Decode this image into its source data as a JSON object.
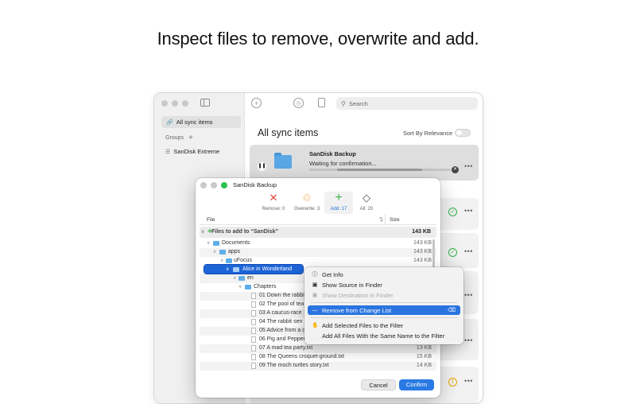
{
  "headline": "Inspect files to remove, overwrite and add.",
  "main": {
    "sidebar": {
      "all_sync": "All sync items",
      "groups": "Groups",
      "groups_add": "+",
      "drive": "SanDisk Extreme"
    },
    "toolbar": {
      "add": "+",
      "search_placeholder": "Search"
    },
    "title": "All sync items",
    "sort_label": "Sort By Relevance",
    "card": {
      "name": "SanDisk Backup",
      "status": "Waiting for confirmation...",
      "progress_fraction": 0.8
    },
    "more": "•••"
  },
  "dialog": {
    "title": "SanDisk Backup",
    "tabs": [
      {
        "glyph": "✕",
        "label": "Remove: 0"
      },
      {
        "glyph": "♲",
        "label": "Overwrite: 3"
      },
      {
        "glyph": "+",
        "label": "Add: 17"
      },
      {
        "glyph": "◇",
        "label": "All: 20"
      }
    ],
    "columns": {
      "file": "File",
      "size": "Size"
    },
    "add_banner": {
      "label": "Files to add to “SanDisk”",
      "size": "143 KB"
    },
    "rows": [
      {
        "name": "Documents",
        "size": "143 KB",
        "type": "folder"
      },
      {
        "name": "apps",
        "size": "143 KB",
        "type": "folder"
      },
      {
        "name": "uFocus",
        "size": "143 KB",
        "type": "folder"
      },
      {
        "name": "Alice in Wonderland",
        "size": "",
        "type": "folder"
      },
      {
        "name": "en",
        "size": "",
        "type": "folder"
      },
      {
        "name": "Chapters",
        "size": "",
        "type": "folder"
      },
      {
        "name": "01 Down the rabbi",
        "size": "",
        "type": "file"
      },
      {
        "name": "02 The pool of tea",
        "size": "",
        "type": "file"
      },
      {
        "name": "03 A caucus-race",
        "size": "",
        "type": "file"
      },
      {
        "name": "04 The rabbit sen",
        "size": "",
        "type": "file"
      },
      {
        "name": "05 Advice from a c",
        "size": "",
        "type": "file"
      },
      {
        "name": "06 Pig and Pepper",
        "size": "",
        "type": "file"
      },
      {
        "name": "07 A mad tea party.txt",
        "size": "13 KB",
        "type": "file"
      },
      {
        "name": "08 The Queens croquet-ground.txt",
        "size": "15 KB",
        "type": "file"
      },
      {
        "name": "09 The moch turtles story.txt",
        "size": "14 KB",
        "type": "file"
      }
    ],
    "cancel": "Cancel",
    "confirm": "Confirm"
  },
  "context_menu": {
    "get_info": "Get Info",
    "show_source": "Show Source in Finder",
    "show_destination": "Show Destination in Finder",
    "remove": "Remove from Change List",
    "add_selected": "Add Selected Files to the Filter",
    "add_all_same": "Add All Files With the Same Name to the Filter"
  },
  "colors": {
    "accent": "#2a74e0",
    "selection": "#1d64d6",
    "add_green": "#34b44a",
    "remove_red": "#e0463c",
    "overwrite_orange": "#f0922a",
    "warning": "#e8a400"
  }
}
